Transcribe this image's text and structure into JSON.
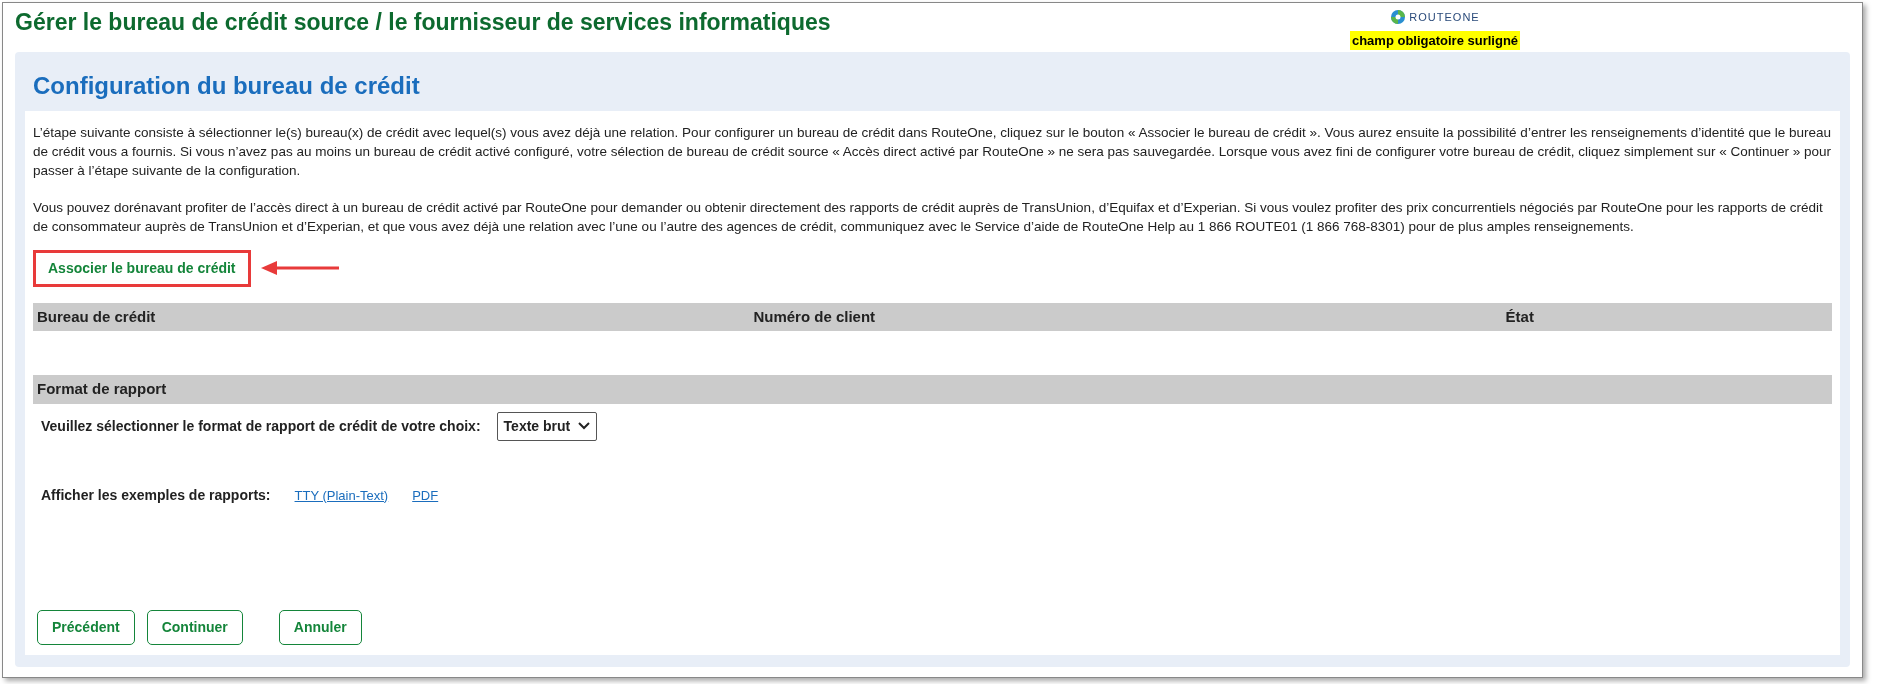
{
  "page_title": "Gérer le bureau de crédit source / le fournisseur de services informatiques",
  "logo": {
    "text": "ROUTEONE"
  },
  "required_note": "champ obligatoire surligné",
  "section_title": "Configuration du bureau de crédit",
  "paragraphs": [
    "L’étape suivante consiste à sélectionner le(s) bureau(x) de crédit avec lequel(s) vous avez déjà une relation. Pour configurer un bureau de crédit dans RouteOne, cliquez sur le bouton « Associer le bureau de crédit ». Vous aurez ensuite la possibilité d’entrer les renseignements d’identité que le bureau de crédit vous a fournis. Si vous n’avez pas au moins un bureau de crédit activé configuré, votre sélection de bureau de crédit source « Accès direct activé par RouteOne » ne sera pas sauvegardée. Lorsque vous avez fini de configurer votre bureau de crédit, cliquez simplement sur « Continuer » pour passer à l’étape suivante de la configuration.",
    "Vous pouvez dorénavant profiter de l’accès direct à un bureau de crédit activé par RouteOne pour demander ou obtenir directement des rapports de crédit auprès de TransUnion, d’Equifax et d’Experian. Si vous voulez profiter des prix concurrentiels négociés par RouteOne pour les rapports de crédit de consommateur auprès de TransUnion et d’Experian, et que vous avez déjà une relation avec l’une ou l’autre des agences de crédit, communiquez avec le Service d’aide de RouteOne Help au 1 866 ROUTE01 (1 866 768-8301) pour de plus amples renseignements."
  ],
  "associate_button": {
    "label": "Associer le bureau de crédit",
    "annotated": true
  },
  "table": {
    "columns": [
      "Bureau de crédit",
      "Numéro de client",
      "État"
    ]
  },
  "report_format": {
    "title": "Format de rapport",
    "prompt": "Veuillez sélectionner le format de rapport de crédit de votre choix:",
    "value": "Texte brut",
    "examples_label": "Afficher les exemples de rapports:",
    "links": [
      "TTY (Plain-Text)",
      "PDF"
    ]
  },
  "buttons": [
    {
      "label": "Précédent",
      "kind": "nav"
    },
    {
      "label": "Continuer",
      "kind": "nav"
    },
    {
      "label": "Annuler",
      "kind": "cancel"
    }
  ]
}
